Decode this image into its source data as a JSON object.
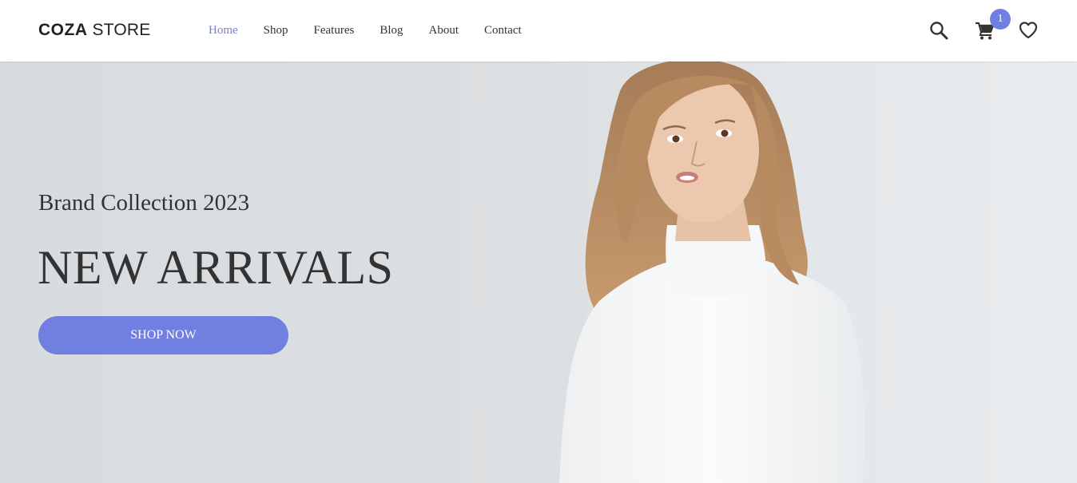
{
  "brand": {
    "logo_bold": "COZA",
    "logo_light": "STORE"
  },
  "nav": {
    "items": [
      {
        "label": "Home",
        "active": true
      },
      {
        "label": "Shop"
      },
      {
        "label": "Features"
      },
      {
        "label": "Blog"
      },
      {
        "label": "About"
      },
      {
        "label": "Contact"
      }
    ]
  },
  "header_icons": {
    "search": "search-icon",
    "cart": "cart-icon",
    "wishlist": "heart-icon",
    "cart_count": "1"
  },
  "hero": {
    "subtitle": "Brand Collection 2023",
    "title": "NEW ARRIVALS",
    "cta_label": "SHOP NOW"
  },
  "colors": {
    "accent": "#717fe0",
    "text": "#333333",
    "hero_bg": "#d8dcde"
  }
}
